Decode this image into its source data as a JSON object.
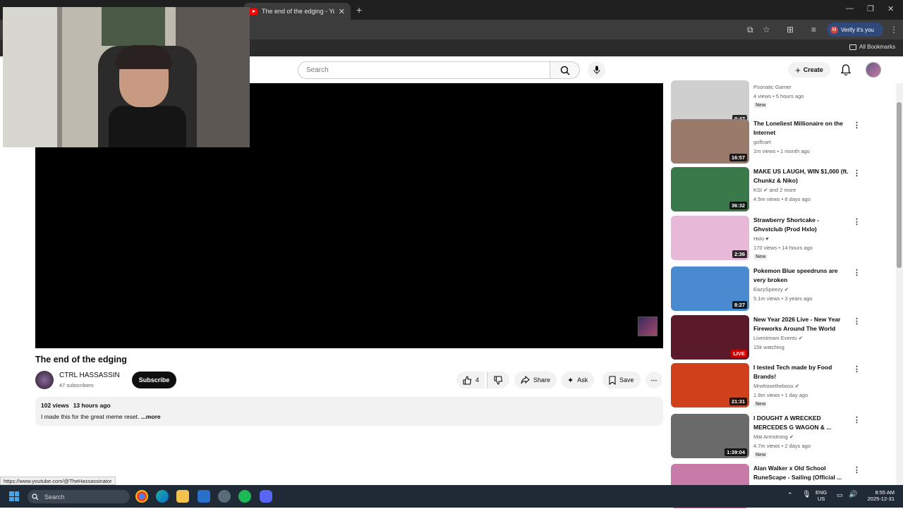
{
  "browser": {
    "active_tab_title": "The end of the edging - YouTube",
    "verify_label": "Verify it's you",
    "verify_avatar": "M",
    "bookmarks_label": "All Bookmarks"
  },
  "youtube": {
    "search_placeholder": "Search",
    "create_label": "Create"
  },
  "video": {
    "title": "The end of the edging",
    "channel_name": "CTRL HASSASSIN",
    "subscribers": "47 subscribers",
    "subscribe_label": "Subscribe",
    "likes": "4",
    "share_label": "Share",
    "ask_label": "Ask",
    "save_label": "Save",
    "views": "102 views",
    "uploaded": "13 hours ago",
    "description": "I made this for the great meme reset.",
    "more_label": "...more"
  },
  "recommendations": [
    {
      "title": "",
      "channel": "Psonatic Gamer",
      "meta": "4 views • 5 hours ago",
      "badge": "New",
      "duration": "0:47",
      "thumb": "#cfcfcf"
    },
    {
      "title": "The Loneliest Millionaire on the Internet",
      "channel": "golfcart",
      "meta": "1m views • 1 month ago",
      "badge": "",
      "duration": "16:57",
      "thumb": "#9a7a6a"
    },
    {
      "title": "MAKE US LAUGH, WIN $1,000 (ft. Chunkz & Niko)",
      "channel": "KSI ✔ and 2 more",
      "meta": "4.5m views • 8 days ago",
      "badge": "",
      "duration": "36:32",
      "thumb": "#3a7a4a"
    },
    {
      "title": "Strawberry Shortcake - Ghvstclub (Prod Hxlo)",
      "channel": "Hxlo ♥",
      "meta": "170 views • 14 hours ago",
      "badge": "New",
      "duration": "2:36",
      "thumb": "#e8b8d8"
    },
    {
      "title": "Pokemon Blue speedruns are very broken",
      "channel": "EazySpeezy ✔",
      "meta": "5.1m views • 3 years ago",
      "badge": "",
      "duration": "8:27",
      "thumb": "#4a8ad0"
    },
    {
      "title": "New Year 2026 Live - New Year Fireworks Around The World",
      "channel": "Livestream Events ✔",
      "meta": "15k watching",
      "badge": "",
      "duration": "LIVE",
      "thumb": "#5a1a2a"
    },
    {
      "title": "I tested Tech made by Food Brands!",
      "channel": "Mrwhosetheboss ✔",
      "meta": "1.9m views • 1 day ago",
      "badge": "New",
      "duration": "21:31",
      "thumb": "#d0401a"
    },
    {
      "title": "I DOUGHT A WRECKED MERCEDES G WAGON & ...",
      "channel": "Mat Armstrong ✔",
      "meta": "4.7m views • 2 days ago",
      "badge": "New",
      "duration": "1:39:04",
      "thumb": "#6a6a6a"
    },
    {
      "title": "Alan Walker x Old School RuneScape - Sailing (Official ...",
      "channel": "",
      "meta": "",
      "badge": "",
      "duration": "",
      "thumb": "#c87aa8"
    }
  ],
  "status_url": "https://www.youtube.com/@TheHassassinator",
  "taskbar": {
    "search_label": "Search",
    "lang_top": "ENG",
    "lang_bottom": "US",
    "time": "8:55 AM",
    "date": "2025-12-31"
  }
}
